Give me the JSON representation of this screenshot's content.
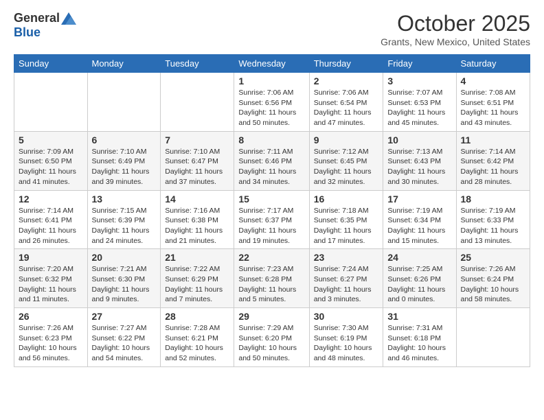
{
  "logo": {
    "general": "General",
    "blue": "Blue"
  },
  "header": {
    "month": "October 2025",
    "location": "Grants, New Mexico, United States"
  },
  "weekdays": [
    "Sunday",
    "Monday",
    "Tuesday",
    "Wednesday",
    "Thursday",
    "Friday",
    "Saturday"
  ],
  "weeks": [
    [
      {
        "day": "",
        "info": ""
      },
      {
        "day": "",
        "info": ""
      },
      {
        "day": "",
        "info": ""
      },
      {
        "day": "1",
        "info": "Sunrise: 7:06 AM\nSunset: 6:56 PM\nDaylight: 11 hours\nand 50 minutes."
      },
      {
        "day": "2",
        "info": "Sunrise: 7:06 AM\nSunset: 6:54 PM\nDaylight: 11 hours\nand 47 minutes."
      },
      {
        "day": "3",
        "info": "Sunrise: 7:07 AM\nSunset: 6:53 PM\nDaylight: 11 hours\nand 45 minutes."
      },
      {
        "day": "4",
        "info": "Sunrise: 7:08 AM\nSunset: 6:51 PM\nDaylight: 11 hours\nand 43 minutes."
      }
    ],
    [
      {
        "day": "5",
        "info": "Sunrise: 7:09 AM\nSunset: 6:50 PM\nDaylight: 11 hours\nand 41 minutes."
      },
      {
        "day": "6",
        "info": "Sunrise: 7:10 AM\nSunset: 6:49 PM\nDaylight: 11 hours\nand 39 minutes."
      },
      {
        "day": "7",
        "info": "Sunrise: 7:10 AM\nSunset: 6:47 PM\nDaylight: 11 hours\nand 37 minutes."
      },
      {
        "day": "8",
        "info": "Sunrise: 7:11 AM\nSunset: 6:46 PM\nDaylight: 11 hours\nand 34 minutes."
      },
      {
        "day": "9",
        "info": "Sunrise: 7:12 AM\nSunset: 6:45 PM\nDaylight: 11 hours\nand 32 minutes."
      },
      {
        "day": "10",
        "info": "Sunrise: 7:13 AM\nSunset: 6:43 PM\nDaylight: 11 hours\nand 30 minutes."
      },
      {
        "day": "11",
        "info": "Sunrise: 7:14 AM\nSunset: 6:42 PM\nDaylight: 11 hours\nand 28 minutes."
      }
    ],
    [
      {
        "day": "12",
        "info": "Sunrise: 7:14 AM\nSunset: 6:41 PM\nDaylight: 11 hours\nand 26 minutes."
      },
      {
        "day": "13",
        "info": "Sunrise: 7:15 AM\nSunset: 6:39 PM\nDaylight: 11 hours\nand 24 minutes."
      },
      {
        "day": "14",
        "info": "Sunrise: 7:16 AM\nSunset: 6:38 PM\nDaylight: 11 hours\nand 21 minutes."
      },
      {
        "day": "15",
        "info": "Sunrise: 7:17 AM\nSunset: 6:37 PM\nDaylight: 11 hours\nand 19 minutes."
      },
      {
        "day": "16",
        "info": "Sunrise: 7:18 AM\nSunset: 6:35 PM\nDaylight: 11 hours\nand 17 minutes."
      },
      {
        "day": "17",
        "info": "Sunrise: 7:19 AM\nSunset: 6:34 PM\nDaylight: 11 hours\nand 15 minutes."
      },
      {
        "day": "18",
        "info": "Sunrise: 7:19 AM\nSunset: 6:33 PM\nDaylight: 11 hours\nand 13 minutes."
      }
    ],
    [
      {
        "day": "19",
        "info": "Sunrise: 7:20 AM\nSunset: 6:32 PM\nDaylight: 11 hours\nand 11 minutes."
      },
      {
        "day": "20",
        "info": "Sunrise: 7:21 AM\nSunset: 6:30 PM\nDaylight: 11 hours\nand 9 minutes."
      },
      {
        "day": "21",
        "info": "Sunrise: 7:22 AM\nSunset: 6:29 PM\nDaylight: 11 hours\nand 7 minutes."
      },
      {
        "day": "22",
        "info": "Sunrise: 7:23 AM\nSunset: 6:28 PM\nDaylight: 11 hours\nand 5 minutes."
      },
      {
        "day": "23",
        "info": "Sunrise: 7:24 AM\nSunset: 6:27 PM\nDaylight: 11 hours\nand 3 minutes."
      },
      {
        "day": "24",
        "info": "Sunrise: 7:25 AM\nSunset: 6:26 PM\nDaylight: 11 hours\nand 0 minutes."
      },
      {
        "day": "25",
        "info": "Sunrise: 7:26 AM\nSunset: 6:24 PM\nDaylight: 10 hours\nand 58 minutes."
      }
    ],
    [
      {
        "day": "26",
        "info": "Sunrise: 7:26 AM\nSunset: 6:23 PM\nDaylight: 10 hours\nand 56 minutes."
      },
      {
        "day": "27",
        "info": "Sunrise: 7:27 AM\nSunset: 6:22 PM\nDaylight: 10 hours\nand 54 minutes."
      },
      {
        "day": "28",
        "info": "Sunrise: 7:28 AM\nSunset: 6:21 PM\nDaylight: 10 hours\nand 52 minutes."
      },
      {
        "day": "29",
        "info": "Sunrise: 7:29 AM\nSunset: 6:20 PM\nDaylight: 10 hours\nand 50 minutes."
      },
      {
        "day": "30",
        "info": "Sunrise: 7:30 AM\nSunset: 6:19 PM\nDaylight: 10 hours\nand 48 minutes."
      },
      {
        "day": "31",
        "info": "Sunrise: 7:31 AM\nSunset: 6:18 PM\nDaylight: 10 hours\nand 46 minutes."
      },
      {
        "day": "",
        "info": ""
      }
    ]
  ]
}
